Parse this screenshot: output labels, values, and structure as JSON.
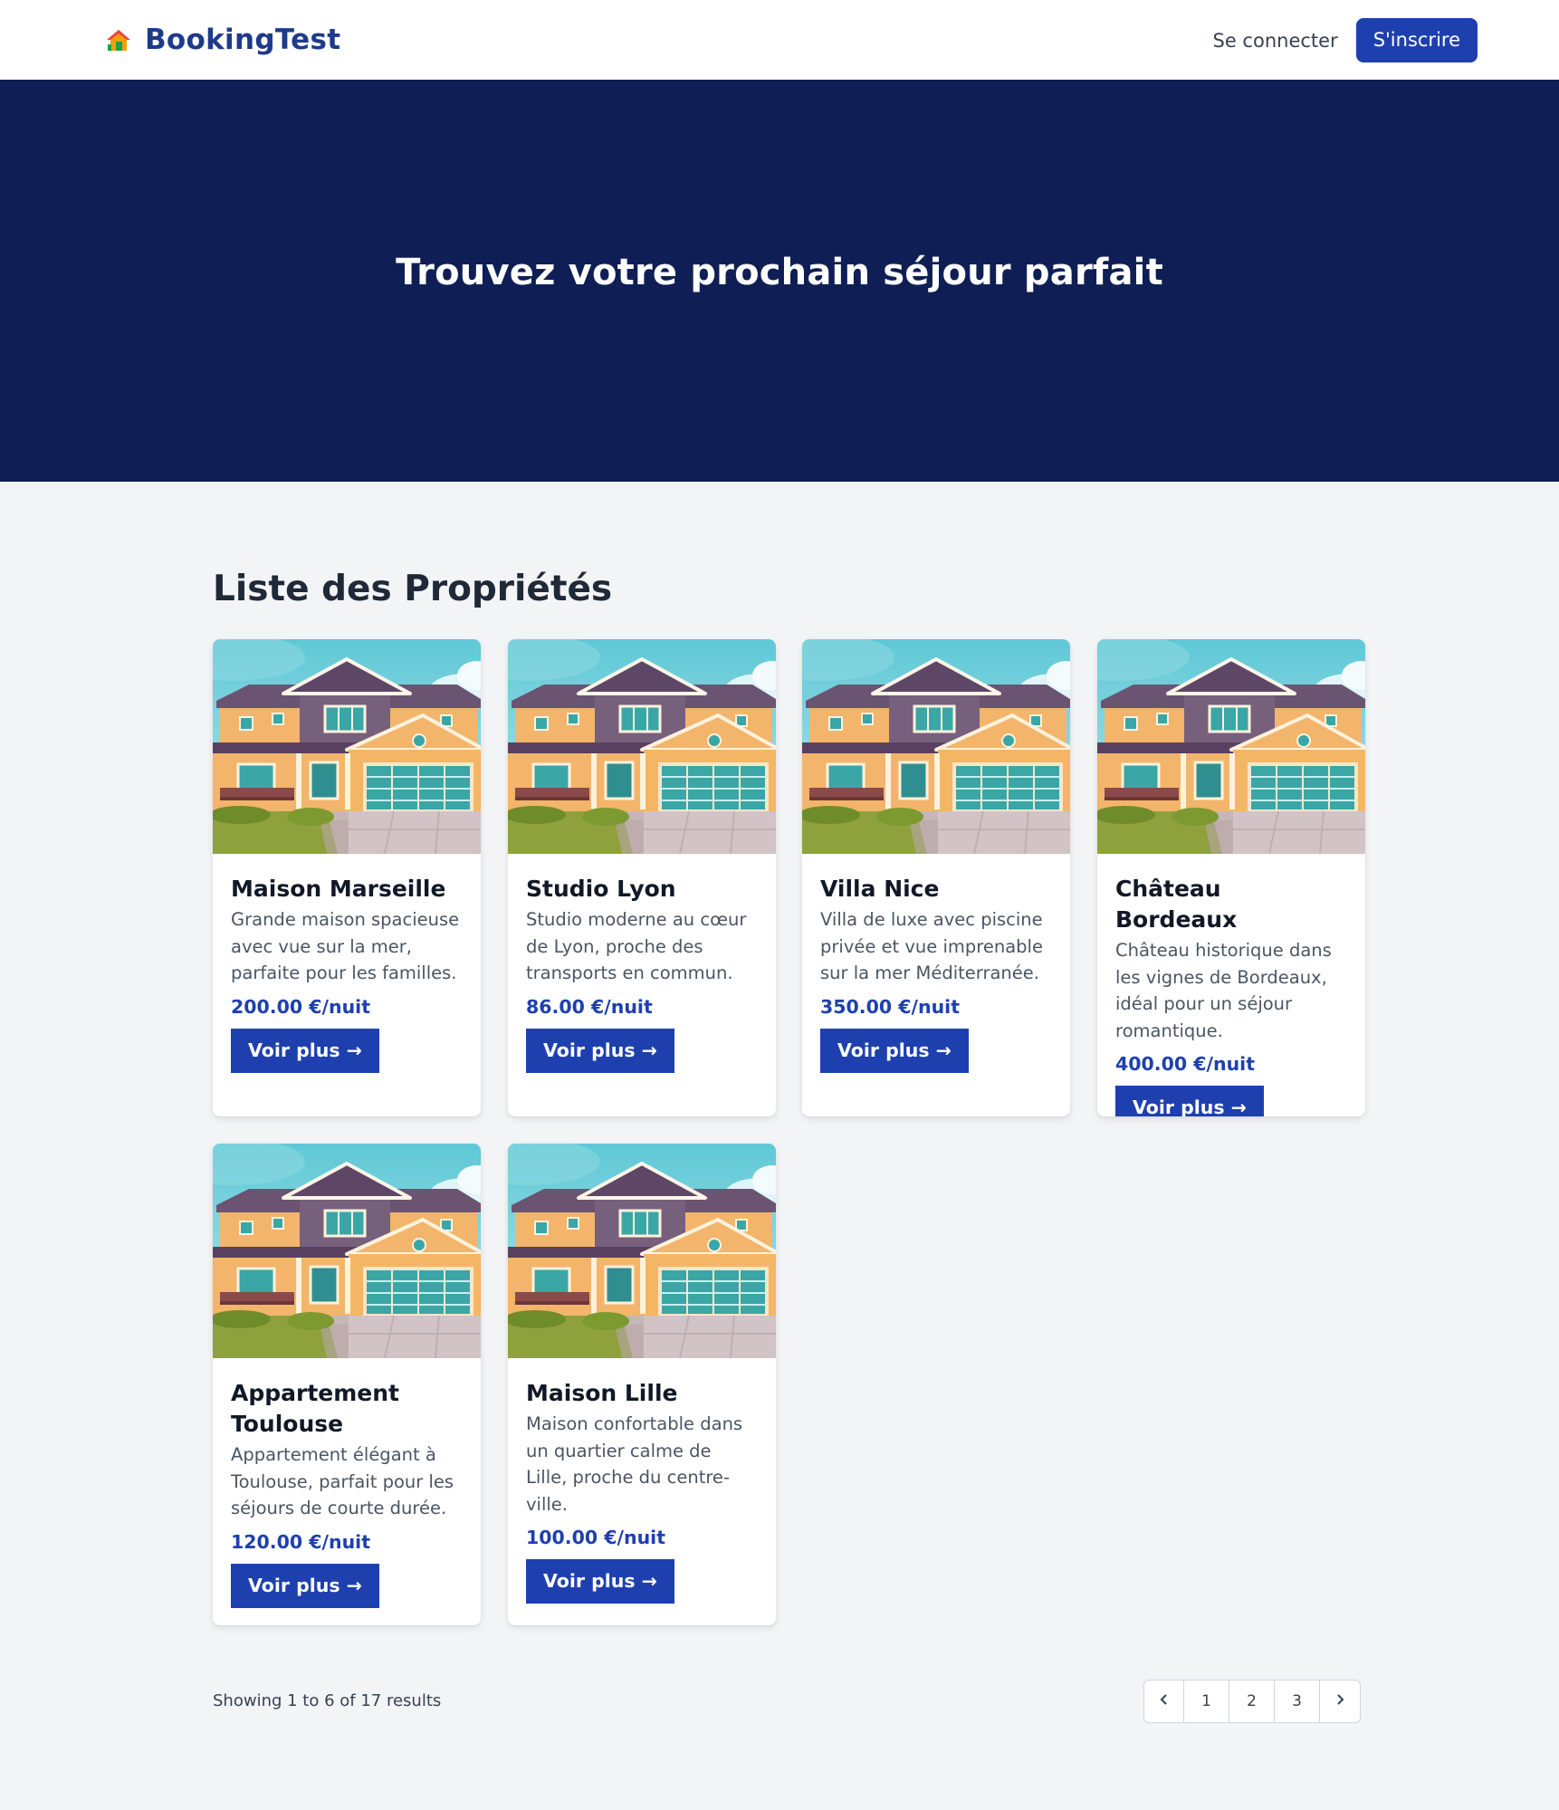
{
  "navbar": {
    "brand": "BookingTest",
    "login": "Se connecter",
    "signup": "S'inscrire"
  },
  "hero": {
    "title": "Trouvez votre prochain séjour parfait"
  },
  "section_title": "Liste des Propriétés",
  "properties": [
    {
      "name": "Maison Marseille",
      "description": "Grande maison spacieuse avec vue sur la mer, parfaite pour les familles.",
      "price": "200.00 €/nuit",
      "cta": "Voir plus →"
    },
    {
      "name": "Studio Lyon",
      "description": "Studio moderne au cœur de Lyon, proche des transports en commun.",
      "price": "86.00 €/nuit",
      "cta": "Voir plus →"
    },
    {
      "name": "Villa Nice",
      "description": "Villa de luxe avec piscine privée et vue imprenable sur la mer Méditerranée.",
      "price": "350.00 €/nuit",
      "cta": "Voir plus →"
    },
    {
      "name": "Château Bordeaux",
      "description": "Château historique dans les vignes de Bordeaux, idéal pour un séjour romantique.",
      "price": "400.00 €/nuit",
      "cta": "Voir plus →"
    },
    {
      "name": "Appartement Toulouse",
      "description": "Appartement élégant à Toulouse, parfait pour les séjours de courte durée.",
      "price": "120.00 €/nuit",
      "cta": "Voir plus →"
    },
    {
      "name": "Maison Lille",
      "description": "Maison confortable dans un quartier calme de Lille, proche du centre-ville.",
      "price": "100.00 €/nuit",
      "cta": "Voir plus →"
    }
  ],
  "pagination": {
    "summary": "Showing 1 to 6 of 17 results",
    "prev_icon": "chevron-left-icon",
    "pages": [
      "1",
      "2",
      "3"
    ],
    "next_icon": "chevron-right-icon"
  },
  "colors": {
    "brand": "#1e3a8a",
    "accent": "#1e40af",
    "hero_bg": "#0f1f55",
    "page_bg": "#f3f4f6"
  }
}
